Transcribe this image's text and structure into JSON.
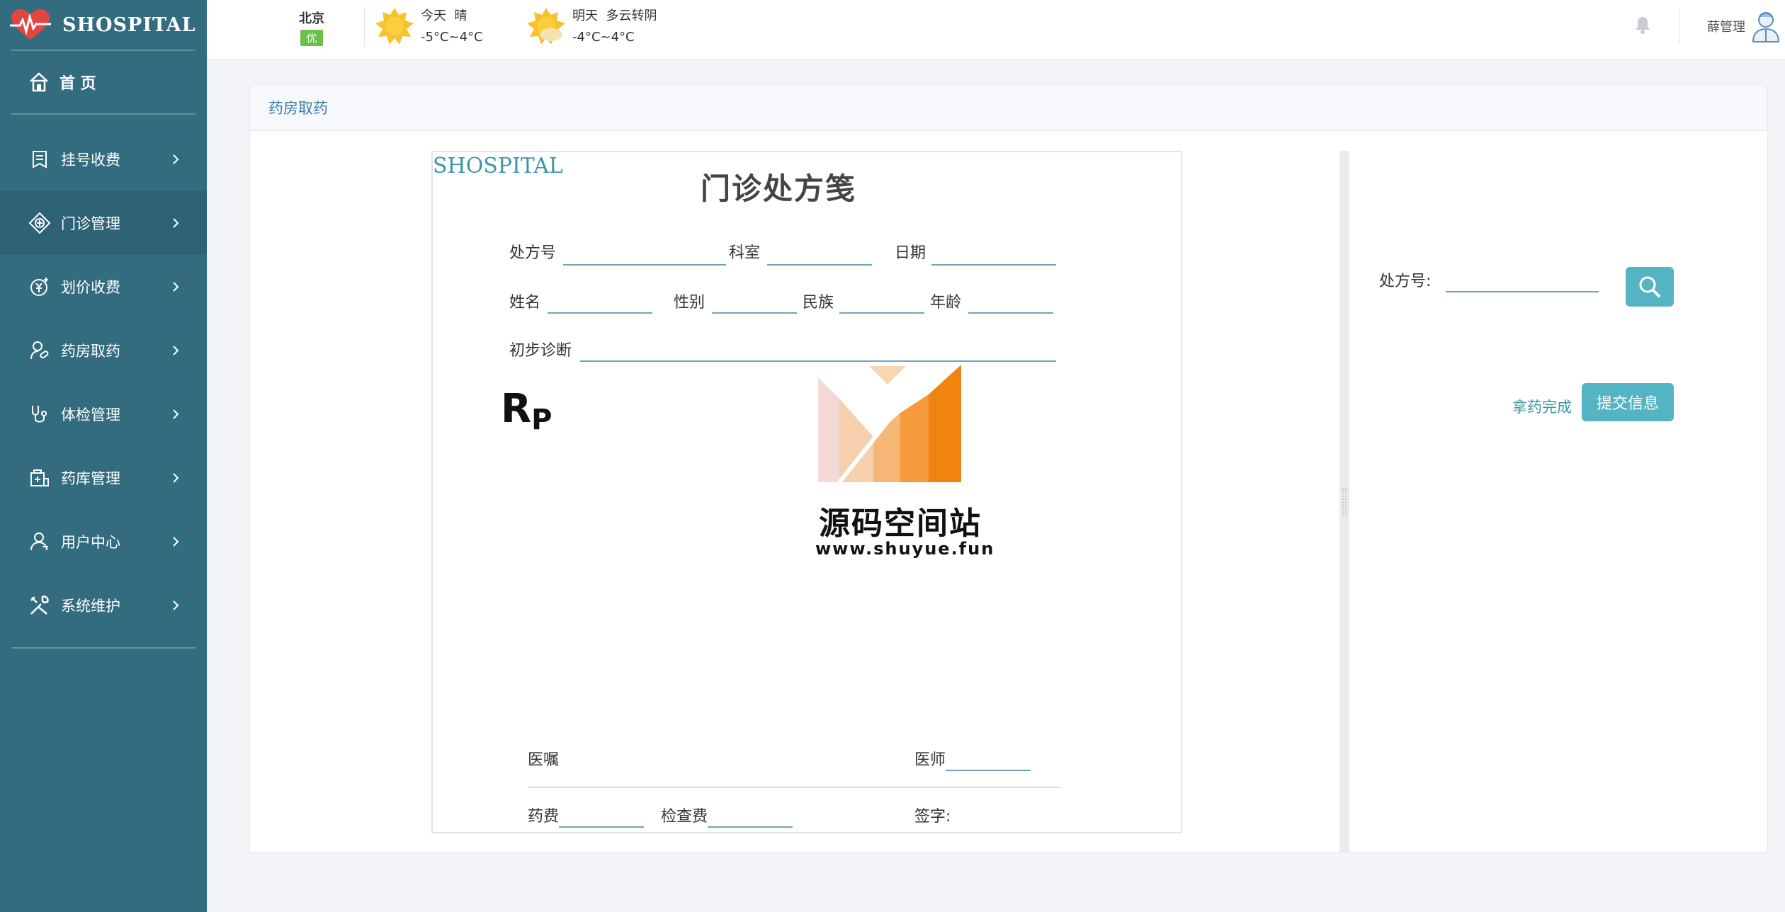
{
  "brand": {
    "name": "SHOSPITAL"
  },
  "nav": {
    "home": "首 页",
    "items": [
      {
        "label": "挂号收费",
        "icon": "register-icon"
      },
      {
        "label": "门诊管理",
        "icon": "outpatient-icon"
      },
      {
        "label": "划价收费",
        "icon": "pricing-icon"
      },
      {
        "label": "药房取药",
        "icon": "pharmacy-icon"
      },
      {
        "label": "体检管理",
        "icon": "stethoscope-icon"
      },
      {
        "label": "药库管理",
        "icon": "medicine-store-icon"
      },
      {
        "label": "用户中心",
        "icon": "user-icon"
      },
      {
        "label": "系统维护",
        "icon": "tools-icon"
      }
    ]
  },
  "header": {
    "weather": {
      "city": "北京",
      "aqi": "优",
      "today": {
        "label": "今天",
        "condition": "晴",
        "temp": "-5°C~4°C"
      },
      "tomorrow": {
        "label": "明天",
        "condition": "多云转阴",
        "temp": "-4°C~4°C"
      }
    },
    "user": "薛管理"
  },
  "page": {
    "title": "药房取药",
    "prescription": {
      "brand": "SHOSPITAL",
      "title": "门诊处方笺",
      "fields": {
        "rx_no": "处方号",
        "dept": "科室",
        "date": "日期",
        "name": "姓名",
        "gender": "性别",
        "ethnicity": "民族",
        "age": "年龄",
        "diagnosis": "初步诊断",
        "advice": "医嘱",
        "doctor": "医师",
        "drug_fee": "药费",
        "exam_fee": "检查费",
        "signature": "签字:"
      },
      "rp_main": "R",
      "rp_sub": "P"
    },
    "watermark": {
      "cn": "源码空间站",
      "en": "www.shuyue.fun"
    },
    "side": {
      "rx_label": "处方号:",
      "rx_value": "",
      "done_label": "拿药完成",
      "submit_label": "提交信息"
    }
  },
  "colors": {
    "sidebar": "#336b7f",
    "accent": "#55b4c4",
    "link": "#3c96a6"
  }
}
